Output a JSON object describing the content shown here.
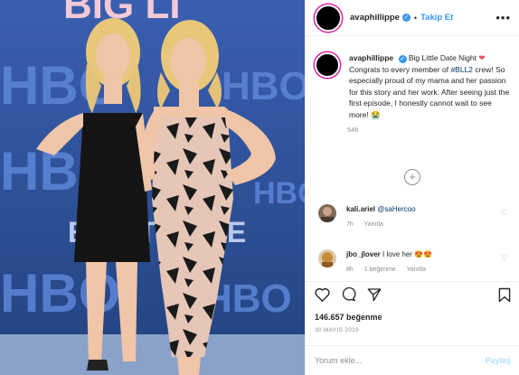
{
  "post": {
    "username": "avaphillippe",
    "verified_mark": "✓",
    "separator": "•",
    "follow_label": "Takip Et",
    "more_label": "•••",
    "image_alt": "Two women posing at a Big Little Lies premiere backdrop",
    "backdrop_texts": [
      "BIG LITTLE LIES",
      "HBO"
    ]
  },
  "caption": {
    "username": "avaphillippe",
    "text_before_heart": "Big Little Date Night",
    "heart": "❤",
    "text_before_tag": "Congrats to every member of",
    "hashtag": "#BLL2",
    "text_after": "crew! So especially proud of my mama and her passion for this story and her work. After seeing just the first episode, I honestly cannot wait to see more!",
    "emoji": "😭",
    "time": "54h"
  },
  "load_more_label": "+",
  "comments": [
    {
      "username": "kali.ariel",
      "mention": "@saHercoo",
      "text": "",
      "time": "7h",
      "reply_label": "Yanıtla",
      "likes_label": ""
    },
    {
      "username": "jbo_jlover",
      "mention": "",
      "text": "I love her",
      "emoji": "😍😍",
      "time": "8h",
      "likes_label": "1 beğenme",
      "reply_label": "Yanıtla"
    }
  ],
  "stats": {
    "likes": "146.657 beğenme",
    "date": "30 MAYIS 2019"
  },
  "add_comment": {
    "placeholder": "Yorum ekle...",
    "post_label": "Paylaş"
  },
  "colors": {
    "accent": "#3897f0",
    "like_red": "#ed4956",
    "muted": "#8e8e8e",
    "backdrop_blue": "#2c4f9a"
  }
}
